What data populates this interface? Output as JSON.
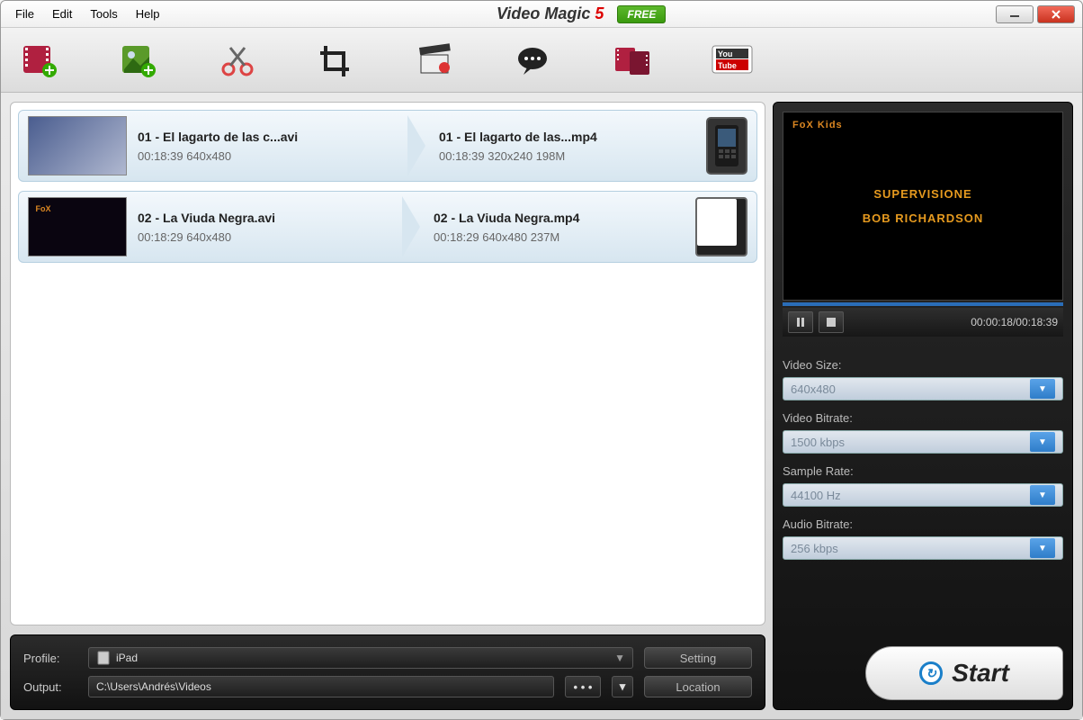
{
  "menu": {
    "file": "File",
    "edit": "Edit",
    "tools": "Tools",
    "help": "Help"
  },
  "title": {
    "name": "Video Magic",
    "version": "5",
    "badge": "FREE"
  },
  "toolbar": {
    "add_video": "add-video",
    "add_image": "add-image",
    "cut": "cut",
    "crop": "crop",
    "effect": "effect",
    "subtitle": "subtitle",
    "merge": "merge",
    "youtube": "youtube"
  },
  "files": [
    {
      "src_name": "01 - El lagarto de las c...avi",
      "src_meta": "00:18:39 640x480",
      "dst_name": "01 - El lagarto de las...mp4",
      "dst_meta": "00:18:39 320x240 198M",
      "device": "phone"
    },
    {
      "src_name": "02 - La Viuda Negra.avi",
      "src_meta": "00:18:29 640x480",
      "dst_name": "02 - La Viuda Negra.mp4",
      "dst_meta": "00:18:29 640x480 237M",
      "device": "tablet"
    }
  ],
  "preview": {
    "logo": "FoX Kids",
    "line1": "SUPERVISIONE",
    "line2": "BOB RICHARDSON",
    "time": "00:00:18/00:18:39"
  },
  "settings": {
    "video_size_label": "Video Size:",
    "video_size": "640x480",
    "video_bitrate_label": "Video Bitrate:",
    "video_bitrate": "1500 kbps",
    "sample_rate_label": "Sample Rate:",
    "sample_rate": "44100 Hz",
    "audio_bitrate_label": "Audio Bitrate:",
    "audio_bitrate": "256 kbps"
  },
  "bottom": {
    "profile_label": "Profile:",
    "profile_value": "iPad",
    "output_label": "Output:",
    "output_value": "C:\\Users\\Andrés\\Videos",
    "setting_btn": "Setting",
    "location_btn": "Location",
    "dots": "• • •"
  },
  "start": "Start"
}
